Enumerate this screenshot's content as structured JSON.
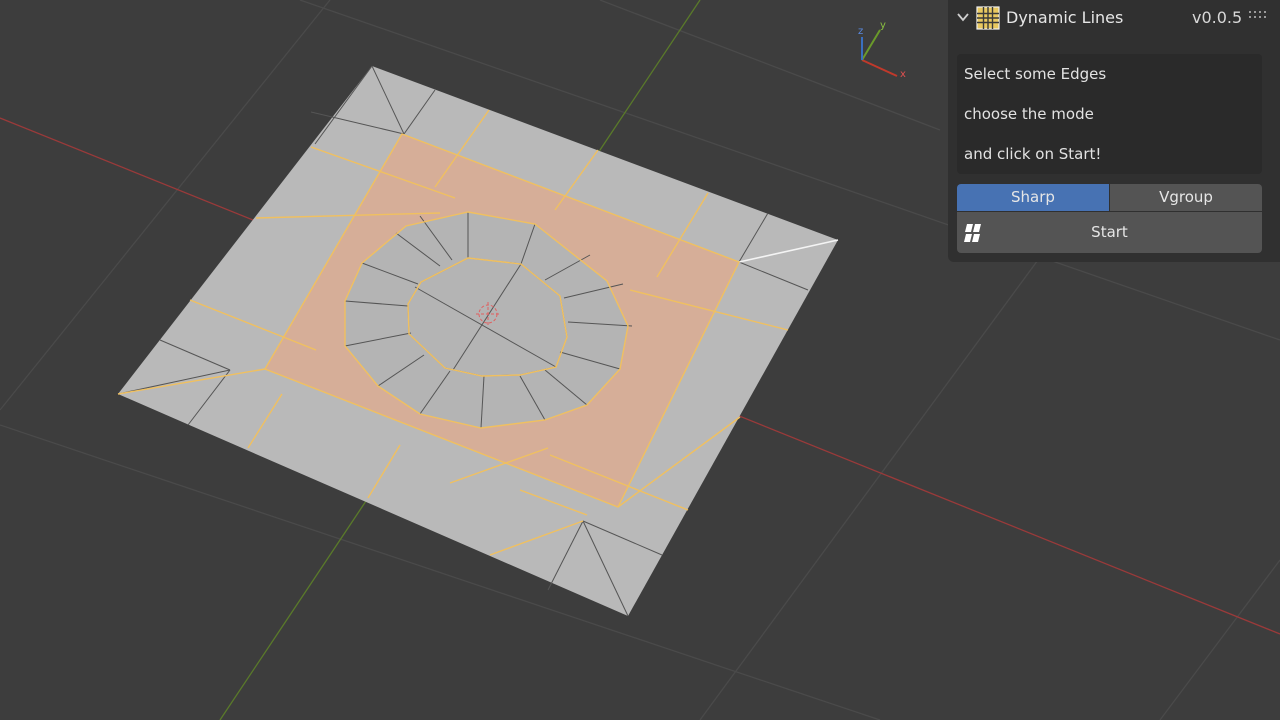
{
  "panel": {
    "title": "Dynamic Lines",
    "version": "v0.0.5",
    "title_icon": "grid-icon",
    "collapse_icon": "chevron-down-icon",
    "drag_icon": "drag-handle-icon",
    "instructions": [
      "Select some Edges",
      "choose the mode",
      "and click on Start!"
    ],
    "modes": [
      {
        "label": "Sharp",
        "active": true
      },
      {
        "label": "Vgroup",
        "active": false
      }
    ],
    "start_label": "Start",
    "start_icon": "sharp-edges-icon"
  },
  "gizmo": {
    "x_label": "x",
    "y_label": "y",
    "z_label": "z"
  },
  "colors": {
    "viewport_bg": "#3d3d3d",
    "panel_bg": "#303030",
    "active_tab": "#4772b3",
    "button_bg": "#545454",
    "selected_edge": "#f0c060",
    "selected_face": "#d8b09a",
    "x_axis": "#c0392b",
    "y_axis": "#6a9a2a"
  }
}
